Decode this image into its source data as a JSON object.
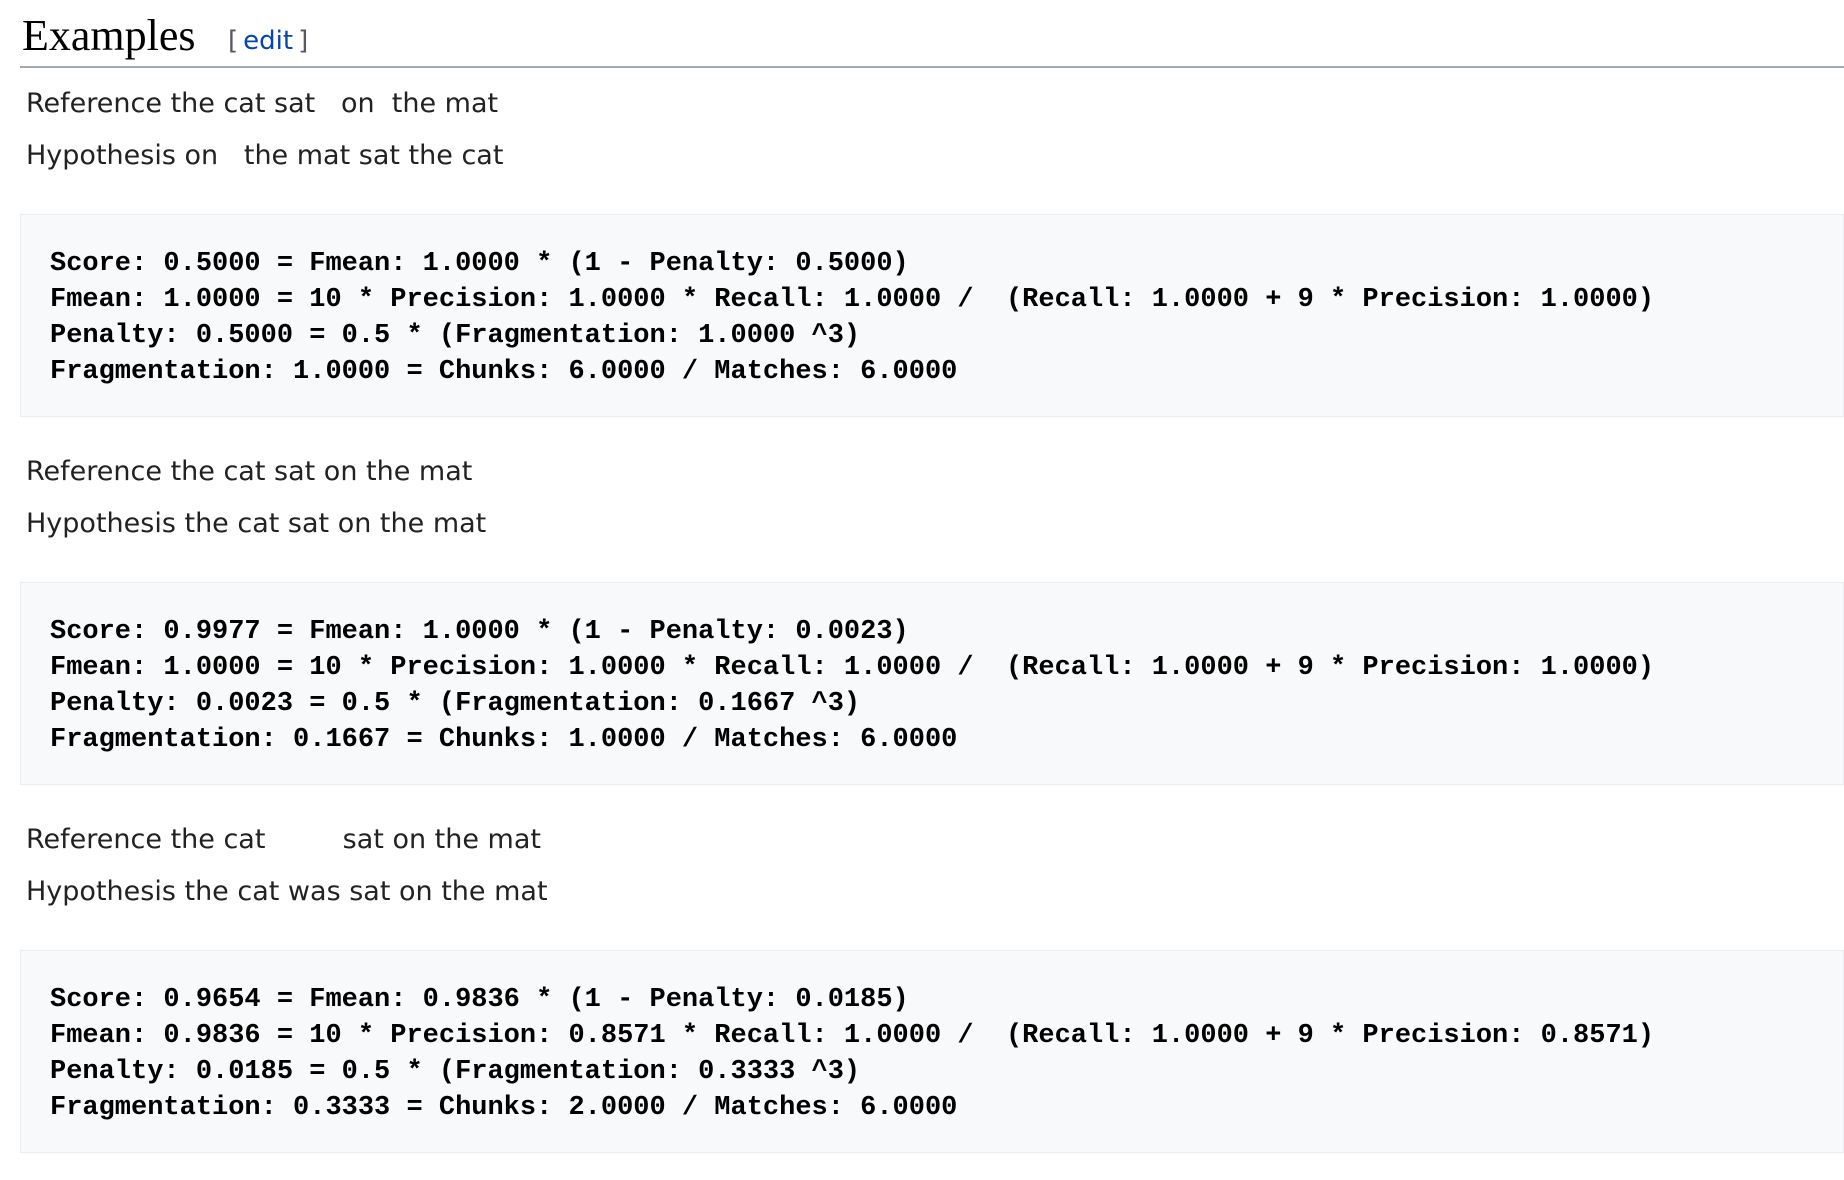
{
  "section": {
    "title": "Examples",
    "edit_open": "[",
    "edit_label": "edit",
    "edit_close": "]"
  },
  "examples": [
    {
      "reference_label": "Reference",
      "reference_text": "the cat sat   on  the mat",
      "hypothesis_label": "Hypothesis",
      "hypothesis_text": "on   the mat sat the cat",
      "code": [
        "Score: 0.5000 = Fmean: 1.0000 * (1 - Penalty: 0.5000)",
        "Fmean: 1.0000 = 10 * Precision: 1.0000 * Recall: 1.0000 /  (Recall: 1.0000 + 9 * Precision: 1.0000)",
        "Penalty: 0.5000 = 0.5 * (Fragmentation: 1.0000 ^3)",
        "Fragmentation: 1.0000 = Chunks: 6.0000 / Matches: 6.0000"
      ]
    },
    {
      "reference_label": "Reference",
      "reference_text": "the cat sat on the mat",
      "hypothesis_label": "Hypothesis",
      "hypothesis_text": "the cat sat on the mat",
      "code": [
        "Score: 0.9977 = Fmean: 1.0000 * (1 - Penalty: 0.0023)",
        "Fmean: 1.0000 = 10 * Precision: 1.0000 * Recall: 1.0000 /  (Recall: 1.0000 + 9 * Precision: 1.0000)",
        "Penalty: 0.0023 = 0.5 * (Fragmentation: 0.1667 ^3)",
        "Fragmentation: 0.1667 = Chunks: 1.0000 / Matches: 6.0000"
      ]
    },
    {
      "reference_label": "Reference",
      "reference_text": "the cat         sat on the mat",
      "hypothesis_label": "Hypothesis",
      "hypothesis_text": "the cat was sat on the mat",
      "code": [
        "Score: 0.9654 = Fmean: 0.9836 * (1 - Penalty: 0.0185)",
        "Fmean: 0.9836 = 10 * Precision: 0.8571 * Recall: 1.0000 /  (Recall: 1.0000 + 9 * Precision: 0.8571)",
        "Penalty: 0.0185 = 0.5 * (Fragmentation: 0.3333 ^3)",
        "Fragmentation: 0.3333 = Chunks: 2.0000 / Matches: 6.0000"
      ]
    }
  ]
}
